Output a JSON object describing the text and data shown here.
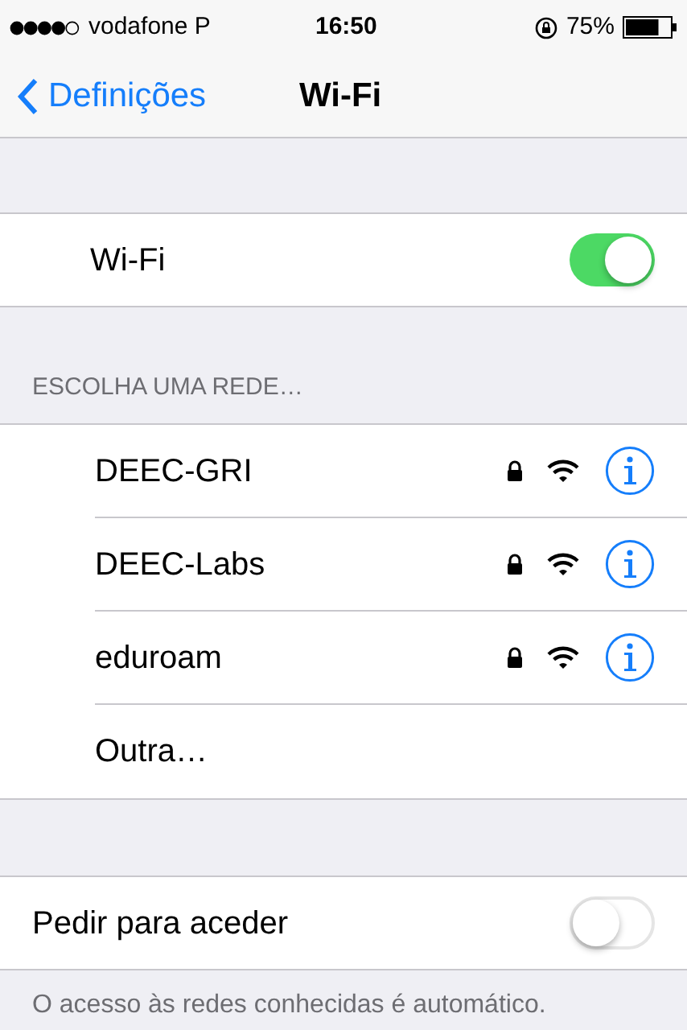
{
  "status_bar": {
    "carrier": "vodafone P",
    "time": "16:50",
    "battery": "75%"
  },
  "nav": {
    "back": "Definições",
    "title": "Wi-Fi"
  },
  "wifi": {
    "label": "Wi-Fi",
    "on": true
  },
  "networks_header": "ESCOLHA UMA REDE…",
  "networks": [
    {
      "kind": "network",
      "name": "DEEC-GRI",
      "locked": true
    },
    {
      "kind": "network",
      "name": "DEEC-Labs",
      "locked": true
    },
    {
      "kind": "network",
      "name": "eduroam",
      "locked": true
    },
    {
      "kind": "other",
      "name": "Outra…"
    }
  ],
  "ask_to_join": {
    "label": "Pedir para aceder",
    "on": false
  },
  "footer": "O acesso às redes conhecidas é automático."
}
